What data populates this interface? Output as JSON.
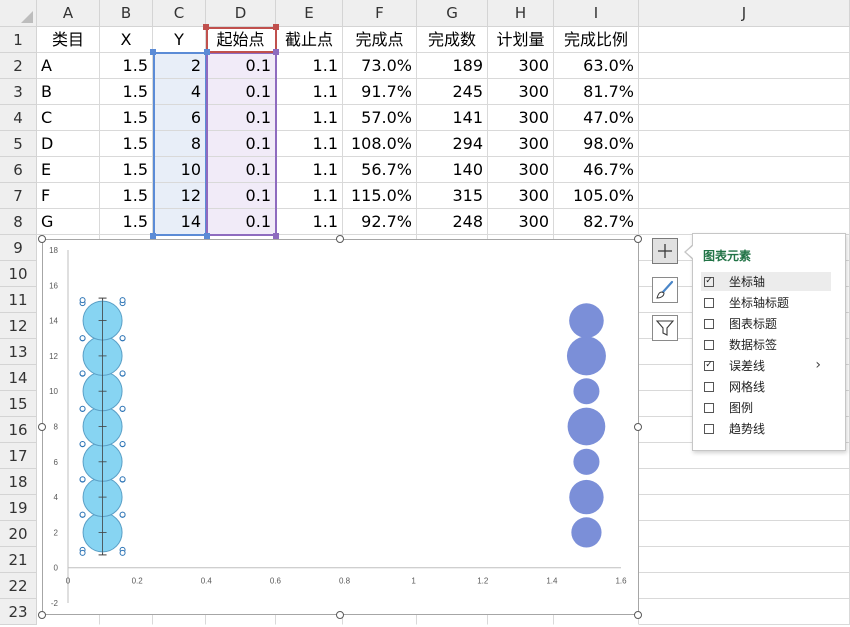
{
  "spreadsheet": {
    "columns": [
      "A",
      "B",
      "C",
      "D",
      "E",
      "F",
      "G",
      "H",
      "I",
      "J"
    ],
    "rows": [
      "1",
      "2",
      "3",
      "4",
      "5",
      "6",
      "7",
      "8",
      "9",
      "10",
      "11",
      "12",
      "13",
      "14",
      "15",
      "16",
      "17",
      "18",
      "19",
      "20",
      "21",
      "22",
      "23"
    ],
    "table": {
      "headers": [
        "类目",
        "X",
        "Y",
        "起始点",
        "截止点",
        "完成点",
        "完成数",
        "计划量",
        "完成比例"
      ],
      "rows": [
        [
          "A",
          "1.5",
          "2",
          "0.1",
          "1.1",
          "73.0%",
          "189",
          "300",
          "63.0%"
        ],
        [
          "B",
          "1.5",
          "4",
          "0.1",
          "1.1",
          "91.7%",
          "245",
          "300",
          "81.7%"
        ],
        [
          "C",
          "1.5",
          "6",
          "0.1",
          "1.1",
          "57.0%",
          "141",
          "300",
          "47.0%"
        ],
        [
          "D",
          "1.5",
          "8",
          "0.1",
          "1.1",
          "108.0%",
          "294",
          "300",
          "98.0%"
        ],
        [
          "E",
          "1.5",
          "10",
          "0.1",
          "1.1",
          "56.7%",
          "140",
          "300",
          "46.7%"
        ],
        [
          "F",
          "1.5",
          "12",
          "0.1",
          "1.1",
          "115.0%",
          "315",
          "300",
          "105.0%"
        ],
        [
          "G",
          "1.5",
          "14",
          "0.1",
          "1.1",
          "92.7%",
          "248",
          "300",
          "82.7%"
        ]
      ]
    }
  },
  "chart_data": {
    "type": "scatter",
    "xlim": [
      0,
      1.6
    ],
    "ylim": [
      -2,
      18
    ],
    "x_ticks": [
      "0",
      "0.2",
      "0.4",
      "0.6",
      "0.8",
      "1",
      "1.2",
      "1.4",
      "1.6"
    ],
    "y_ticks": [
      "-2",
      "0",
      "2",
      "4",
      "6",
      "8",
      "10",
      "12",
      "14",
      "16",
      "18"
    ],
    "grid": false,
    "series": [
      {
        "points": [
          {
            "x": 0.1,
            "y": 2
          },
          {
            "x": 0.1,
            "y": 4
          },
          {
            "x": 0.1,
            "y": 6
          },
          {
            "x": 0.1,
            "y": 8
          },
          {
            "x": 0.1,
            "y": 10
          },
          {
            "x": 0.1,
            "y": 12
          },
          {
            "x": 0.1,
            "y": 14
          }
        ],
        "error_bars": true,
        "selected": true,
        "color": "#87d4f2"
      },
      {
        "points": [
          {
            "x": 1.5,
            "y": 2,
            "size": 189
          },
          {
            "x": 1.5,
            "y": 4,
            "size": 245
          },
          {
            "x": 1.5,
            "y": 6,
            "size": 141
          },
          {
            "x": 1.5,
            "y": 8,
            "size": 294
          },
          {
            "x": 1.5,
            "y": 10,
            "size": 140
          },
          {
            "x": 1.5,
            "y": 12,
            "size": 315
          },
          {
            "x": 1.5,
            "y": 14,
            "size": 248
          }
        ],
        "color": "#7b8fd8"
      }
    ]
  },
  "chart_elements_panel": {
    "title": "图表元素",
    "items": [
      {
        "label": "坐标轴",
        "checked": true,
        "highlighted": true
      },
      {
        "label": "坐标轴标题",
        "checked": false
      },
      {
        "label": "图表标题",
        "checked": false
      },
      {
        "label": "数据标签",
        "checked": false
      },
      {
        "label": "误差线",
        "checked": true,
        "has_submenu": true
      },
      {
        "label": "网格线",
        "checked": false
      },
      {
        "label": "图例",
        "checked": false
      },
      {
        "label": "趋势线",
        "checked": false
      }
    ]
  },
  "chart_buttons": [
    "plus-icon",
    "brush-icon",
    "filter-icon"
  ],
  "colors": {
    "selection_y": "#5b8bd6",
    "selection_start": "#8e6bbf",
    "selection_header": "#c0504d",
    "panel_title": "#217346"
  }
}
